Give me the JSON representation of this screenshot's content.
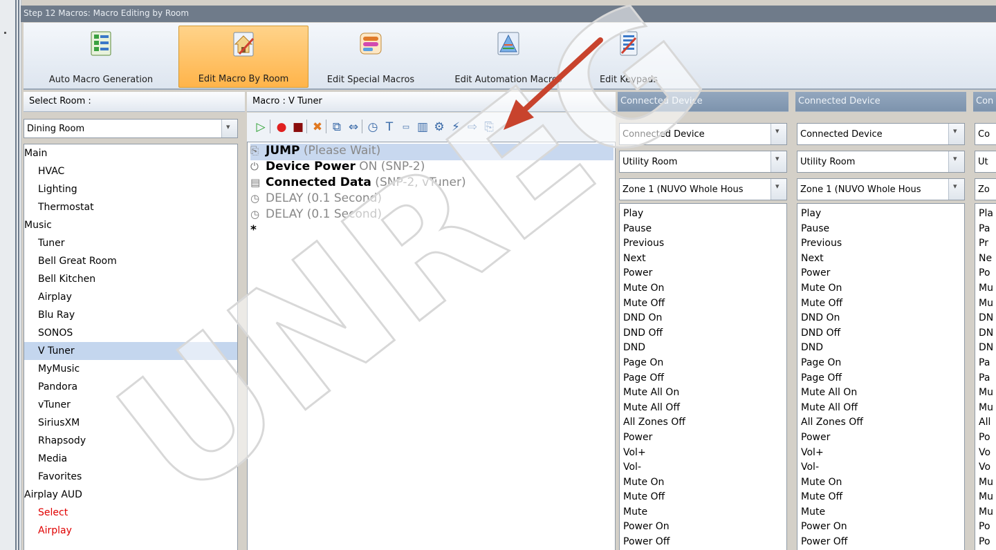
{
  "window": {
    "title": "Step 12 Macros: Macro Editing by Room"
  },
  "ribbon": {
    "buttons": [
      {
        "label": "Auto Macro Generation",
        "icon": "list-icon",
        "active": false
      },
      {
        "label": "Edit Macro By Room",
        "icon": "house-edit-icon",
        "active": true
      },
      {
        "label": "Edit Special Macros",
        "icon": "special-macro-icon",
        "active": false
      },
      {
        "label": "Edit Automation Macros",
        "icon": "automation-icon",
        "active": false
      },
      {
        "label": "Edit Keypads",
        "icon": "keypad-edit-icon",
        "active": false
      }
    ]
  },
  "room_panel": {
    "header": "Select Room :",
    "selected_room": "Dining Room",
    "items": [
      {
        "label": "Main",
        "level": 0
      },
      {
        "label": "HVAC",
        "level": 1
      },
      {
        "label": "Lighting",
        "level": 1
      },
      {
        "label": "Thermostat",
        "level": 1
      },
      {
        "label": "Music",
        "level": 0
      },
      {
        "label": "Tuner",
        "level": 1
      },
      {
        "label": "Bell Great Room",
        "level": 1
      },
      {
        "label": "Bell Kitchen",
        "level": 1
      },
      {
        "label": "Airplay",
        "level": 1
      },
      {
        "label": "Blu Ray",
        "level": 1
      },
      {
        "label": "SONOS",
        "level": 1
      },
      {
        "label": "V Tuner",
        "level": 1,
        "selected": true
      },
      {
        "label": "MyMusic",
        "level": 1
      },
      {
        "label": "Pandora",
        "level": 1
      },
      {
        "label": "vTuner",
        "level": 1
      },
      {
        "label": "SiriusXM",
        "level": 1
      },
      {
        "label": "Rhapsody",
        "level": 1
      },
      {
        "label": "Media",
        "level": 1
      },
      {
        "label": "Favorites",
        "level": 1
      },
      {
        "label": "Airplay AUD",
        "level": 0
      },
      {
        "label": "Select",
        "level": 1,
        "color": "red"
      },
      {
        "label": "Airplay",
        "level": 1,
        "color": "red"
      }
    ]
  },
  "macro_panel": {
    "header": "Macro : V Tuner",
    "toolbar_icons": [
      "play-icon",
      "record-icon",
      "stop-icon",
      "delete-icon",
      "copy-icon",
      "swap-icon",
      "delay-icon",
      "text-icon",
      "variable-icon",
      "chart-icon",
      "device-icon",
      "power-icon",
      "data-icon",
      "jump-icon"
    ],
    "steps": [
      {
        "name": "JUMP",
        "detail": " (Please Wait)",
        "icon": "jump-icon",
        "selected": true
      },
      {
        "name": "Device Power",
        "detail": " ON (SNP-2)",
        "icon": "power-icon"
      },
      {
        "name": "Connected Data",
        "detail": " (SNP-2, vTuner)",
        "icon": "data-icon"
      },
      {
        "name": "DELAY",
        "detail": " (0.1 Second)",
        "icon": "clock-icon",
        "gray": true
      },
      {
        "name": "DELAY",
        "detail": " (0.1 Second)",
        "icon": "clock-icon",
        "gray": true
      }
    ],
    "new_row_marker": "*"
  },
  "device_panels": [
    {
      "header": "Connected Device",
      "device": "Connected Device",
      "room": "Utility Room",
      "zone": "Zone 1 (NUVO Whole Hous",
      "commands": [
        "Play",
        "Pause",
        "Previous",
        "Next",
        "Power",
        "Mute On",
        "Mute Off",
        "DND On",
        "DND Off",
        "DND",
        "Page On",
        "Page Off",
        "Mute All On",
        "Mute All Off",
        "All Zones Off",
        "Power",
        "Vol+",
        "Vol-",
        "Mute On",
        "Mute Off",
        "Mute",
        "Power On",
        "Power Off"
      ]
    },
    {
      "header": "Connected Device",
      "device": "Connected Device",
      "room": "Utility Room",
      "zone": "Zone 1 (NUVO Whole Hous",
      "commands": [
        "Play",
        "Pause",
        "Previous",
        "Next",
        "Power",
        "Mute On",
        "Mute Off",
        "DND On",
        "DND Off",
        "DND",
        "Page On",
        "Page Off",
        "Mute All On",
        "Mute All Off",
        "All Zones Off",
        "Power",
        "Vol+",
        "Vol-",
        "Mute On",
        "Mute Off",
        "Mute",
        "Power On",
        "Power Off"
      ]
    },
    {
      "header": "Con",
      "device": "Co",
      "room": "Ut",
      "zone": "Zo",
      "commands": [
        "Pla",
        "Pa",
        "Pr",
        "Ne",
        "Po",
        "Mu",
        "Mu",
        "DN",
        "DN",
        "DN",
        "Pa",
        "Pa",
        "Mu",
        "Mu",
        "All",
        "Po",
        "Vo",
        "Vo",
        "Mu",
        "Mu",
        "Mu",
        "Po",
        "Po"
      ]
    }
  ],
  "watermark": {
    "text": "UNREG"
  },
  "colors": {
    "active_ribbon": "#ffb44a",
    "selection": "#c4d6ee",
    "red_text": "#e00000",
    "annotation_arrow": "#c8432d"
  }
}
